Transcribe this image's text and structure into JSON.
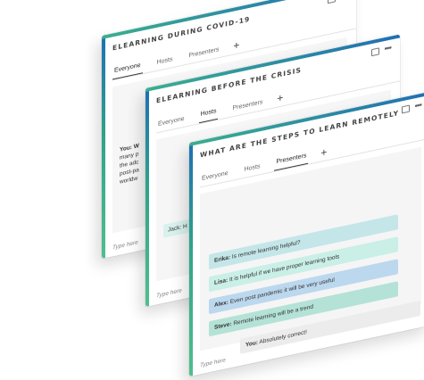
{
  "panels": [
    {
      "title": "ELEARNING DURING COVID-19",
      "tabs": [
        "Everyone",
        "Hosts",
        "Presenters"
      ],
      "active_tab": "Everyone",
      "message_lines": [
        "You: W",
        "many p",
        "the adc",
        "post-pa",
        "worldw"
      ],
      "input_placeholder": "Type here"
    },
    {
      "title": "ELEARNING BEFORE THE CRISIS",
      "tabs": [
        "Everyone",
        "Hosts",
        "Presenters"
      ],
      "active_tab": "Hosts",
      "message": "Jack: H",
      "input_placeholder": "Type here"
    },
    {
      "title": "WHAT ARE THE STEPS TO LEARN REMOTELY",
      "tabs": [
        "Everyone",
        "Hosts",
        "Presenters"
      ],
      "active_tab": "Presenters",
      "messages": [
        {
          "author": "Erika:",
          "text": "Is remote learning helpful?",
          "color": "#c4e6e9"
        },
        {
          "author": "Lisa:",
          "text": "It is helpful if we have proper learning tools",
          "color": "#c9efe6"
        },
        {
          "author": "Alex:",
          "text": "Even post pandemic it will be very useful",
          "color": "#bcd8ee"
        },
        {
          "author": "Steve:",
          "text": "Remote learning will be a trend",
          "color": "#b4e2d6"
        },
        {
          "author": "You:",
          "text": "Absolutely correct!",
          "color": "#ececec"
        }
      ],
      "input_placeholder": "Type here"
    }
  ],
  "icons": {
    "restore": "restore-icon",
    "more": "more-icon",
    "add_tab": "plus-icon"
  }
}
